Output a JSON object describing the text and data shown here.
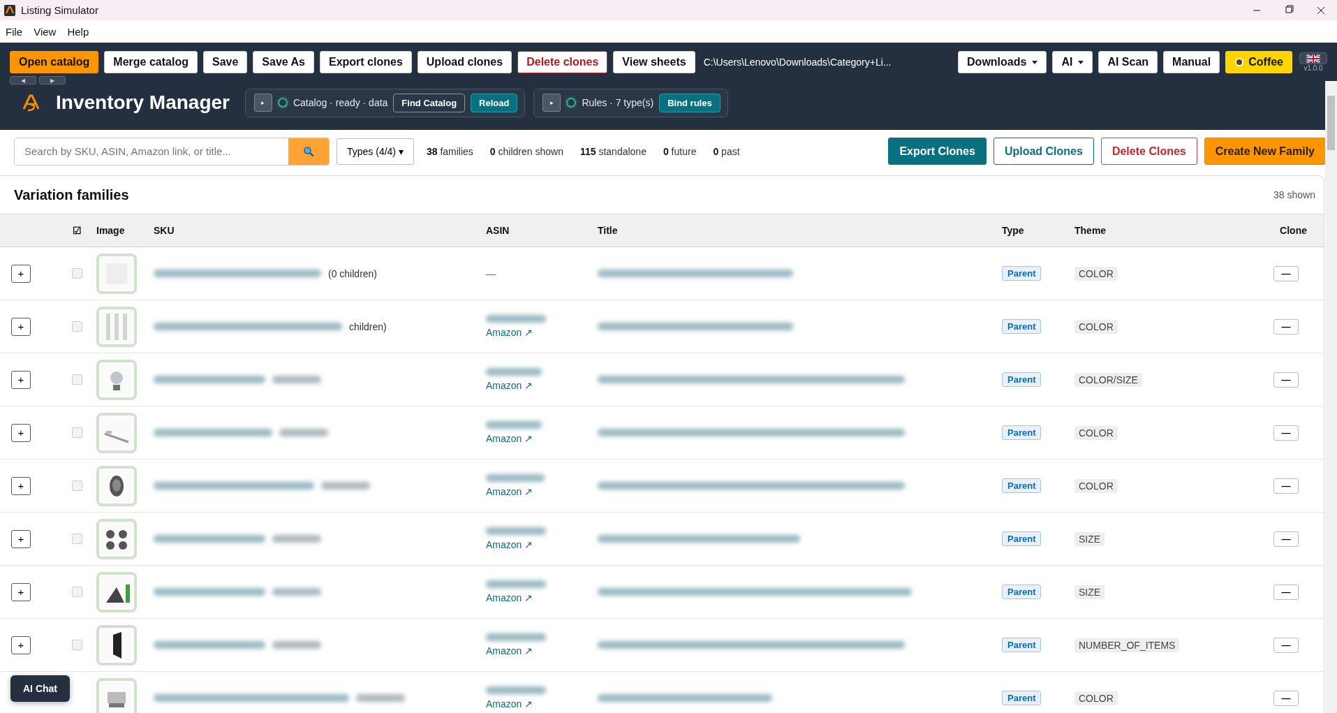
{
  "window": {
    "title": "Listing Simulator"
  },
  "menu": [
    "File",
    "View",
    "Help"
  ],
  "toolbar": {
    "buttons": [
      {
        "label": "Open catalog",
        "kind": "primary"
      },
      {
        "label": "Merge catalog",
        "kind": "plain"
      },
      {
        "label": "Save",
        "kind": "plain"
      },
      {
        "label": "Save As",
        "kind": "plain"
      },
      {
        "label": "Export clones",
        "kind": "plain"
      },
      {
        "label": "Upload clones",
        "kind": "plain"
      },
      {
        "label": "Delete clones",
        "kind": "danger"
      },
      {
        "label": "View sheets",
        "kind": "plain"
      }
    ],
    "path": "C:\\Users\\Lenovo\\Downloads\\Category+Li...",
    "right_buttons": [
      {
        "label": "Downloads",
        "kind": "dropdown"
      },
      {
        "label": "AI",
        "kind": "dropdown"
      },
      {
        "label": "AI Scan",
        "kind": "plain"
      },
      {
        "label": "Manual",
        "kind": "plain"
      },
      {
        "label": "Coffee",
        "kind": "coffee"
      }
    ],
    "version": "v1.0.0"
  },
  "header": {
    "nav": [
      "◀",
      "▶"
    ],
    "title": "Inventory Manager",
    "panels": [
      {
        "toggle": "▸",
        "color": "#2fb58a",
        "status": "Catalog · ready · data",
        "buttons": [
          {
            "label": "Find Catalog",
            "kind": "outline"
          },
          {
            "label": "Reload",
            "kind": "teal"
          }
        ]
      },
      {
        "toggle": "▸",
        "color": "#2fb58a",
        "status": "Rules · 7 type(s)",
        "buttons": [
          {
            "label": "Bind rules",
            "kind": "teal"
          }
        ]
      }
    ]
  },
  "filter": {
    "search": {
      "placeholder": "Search by SKU, ASIN, Amazon link, or title..."
    },
    "types": "Types (4/4) ▾",
    "stats": [
      "**38** families",
      "**0** children shown",
      "**115** standalone",
      "**0** future",
      "**0** past"
    ],
    "buttons": [
      {
        "label": "Export Clones",
        "kind": "teal"
      },
      {
        "label": "Upload Clones",
        "kind": "outline"
      },
      {
        "label": "Delete Clones",
        "kind": "danger"
      },
      {
        "label": "Create New Family",
        "kind": "primary"
      }
    ]
  },
  "table": {
    "title": "Variation families",
    "count": "38 shown",
    "select_all": {
      "label": "☑",
      "checked": true
    },
    "columns": [
      "Image",
      "SKU",
      "ASIN",
      "Title",
      "Type",
      "Theme",
      "Clone"
    ],
    "rows": [
      {
        "expand": "+",
        "checked": false,
        "sku_note": "(0 children)",
        "asin": "—",
        "type": "Parent",
        "theme": "COLOR",
        "clone": "—"
      },
      {
        "expand": "+",
        "checked": false,
        "sku_note": "children)",
        "link": "Amazon ↗",
        "type": "Parent",
        "theme": "COLOR",
        "clone": "—"
      },
      {
        "expand": "+",
        "checked": false,
        "link": "Amazon ↗",
        "type": "Parent",
        "theme": "COLOR/SIZE",
        "clone": "—"
      },
      {
        "expand": "+",
        "checked": false,
        "link": "Amazon ↗",
        "type": "Parent",
        "theme": "COLOR",
        "clone": "—"
      },
      {
        "expand": "+",
        "checked": false,
        "link": "Amazon ↗",
        "type": "Parent",
        "theme": "COLOR",
        "clone": "—"
      },
      {
        "expand": "+",
        "checked": false,
        "link": "Amazon ↗",
        "type": "Parent",
        "theme": "SIZE",
        "clone": "—"
      },
      {
        "expand": "+",
        "checked": false,
        "link": "Amazon ↗",
        "type": "Parent",
        "theme": "SIZE",
        "clone": "—"
      },
      {
        "expand": "+",
        "checked": false,
        "link": "Amazon ↗",
        "type": "Parent",
        "theme": "NUMBER_OF_ITEMS",
        "clone": "—"
      },
      {
        "link": "Amazon ↗",
        "type": "Parent",
        "theme": "COLOR",
        "clone": "—"
      }
    ]
  },
  "chat_button": "AI Chat"
}
